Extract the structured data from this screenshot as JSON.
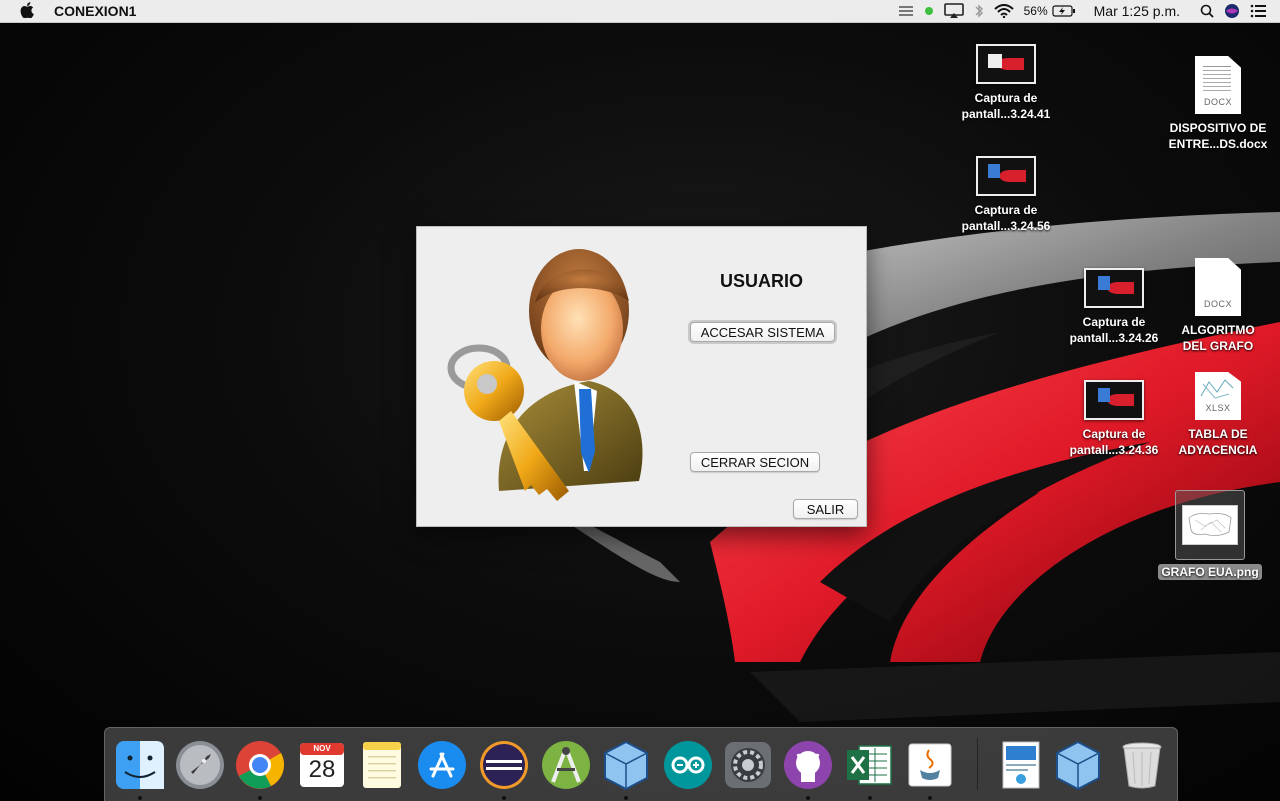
{
  "menubar": {
    "app_name": "CONEXION1",
    "battery_percent": "56%",
    "clock": "Mar 1:25 p.m."
  },
  "desktop_icons": [
    {
      "label_line1": "Captura de",
      "label_line2": "pantall...3.24.41",
      "kind": "screenshot"
    },
    {
      "label_line1": "Captura de",
      "label_line2": "pantall...3.24.56",
      "kind": "screenshot"
    },
    {
      "label_line1": "Captura de",
      "label_line2": "pantall...3.24.26",
      "kind": "screenshot"
    },
    {
      "label_line1": "Captura de",
      "label_line2": "pantall...3.24.36",
      "kind": "screenshot"
    },
    {
      "label_line1": "DISPOSITIVO DE",
      "label_line2": "ENTRE...DS.docx",
      "kind": "document",
      "type": "DOCX"
    },
    {
      "label_line1": "ALGORITMO",
      "label_line2": "DEL GRAFO",
      "kind": "document",
      "type": "DOCX"
    },
    {
      "label_line1": "TABLA DE",
      "label_line2": "ADYACENCIA",
      "kind": "document",
      "type": "XLSX"
    },
    {
      "label_line1": "GRAFO EUA.png",
      "kind": "image",
      "selected": true
    }
  ],
  "dialog": {
    "title": "USUARIO",
    "buttons": {
      "access": "ACCESAR SISTEMA",
      "close_session": "CERRAR SECION",
      "exit": "SALIR"
    }
  },
  "dock": {
    "items": [
      "finder",
      "launchpad",
      "chrome",
      "calendar",
      "notes",
      "app-store",
      "eclipse",
      "android-studio",
      "virtualbox",
      "arduino",
      "system-preferences",
      "github-desktop",
      "excel",
      "java",
      "document-preview",
      "virtualbox-vm",
      "trash"
    ],
    "calendar_month": "NOV",
    "calendar_day": "28"
  },
  "colors": {
    "menubar_bg": "#ececec",
    "dialog_bg": "#eeeeee",
    "wallpaper_red": "#e8202e",
    "dock_bg": "#505050"
  }
}
